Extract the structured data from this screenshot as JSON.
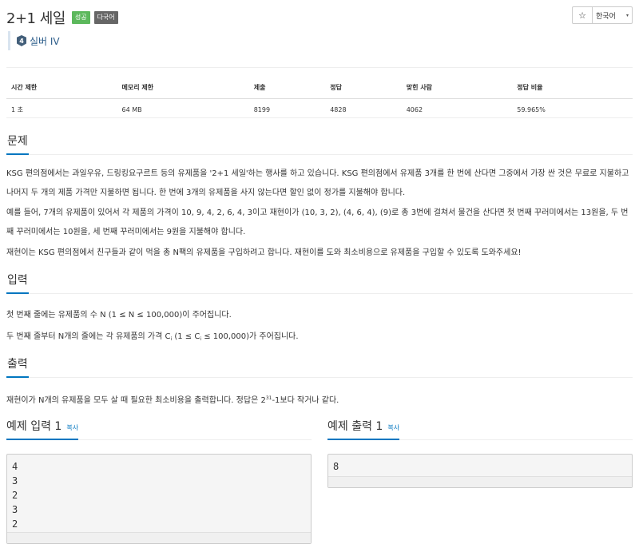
{
  "problem": {
    "title": "2+1 세일",
    "badges": {
      "result": "성공",
      "language": "다국어"
    },
    "tier": {
      "level_numeral": "4",
      "label": "실버 IV"
    }
  },
  "toolbar": {
    "star": "☆",
    "language": "한국어",
    "caret": "▾"
  },
  "info_table": {
    "headers": [
      "시간 제한",
      "메모리 제한",
      "제출",
      "정답",
      "맞힌 사람",
      "정답 비율"
    ],
    "values": [
      "1 초",
      "64 MB",
      "8199",
      "4828",
      "4062",
      "59.965%"
    ]
  },
  "sections": {
    "problem": {
      "heading": "문제",
      "paragraphs": [
        "KSG 편의점에서는 과일우유, 드링킹요구르트 등의 유제품을 '2+1 세일'하는 행사를 하고 있습니다. KSG 편의점에서 유제품 3개를 한 번에 산다면 그중에서 가장 싼 것은 무료로 지불하고 나머지 두 개의 제품 가격만 지불하면 됩니다. 한 번에 3개의 유제품을 사지 않는다면 할인 없이 정가를 지불해야 합니다.",
        "예를 들어, 7개의 유제품이 있어서 각 제품의 가격이 10, 9, 4, 2, 6, 4, 3이고 재현이가 (10, 3, 2), (4, 6, 4), (9)로 총 3번에 걸쳐서 물건을 산다면 첫 번째 꾸러미에서는 13원을, 두 번째 꾸러미에서는 10원을, 세 번째 꾸러미에서는 9원을 지불해야 합니다.",
        "재현이는 KSG 편의점에서 친구들과 같이 먹을 총 N팩의 유제품을 구입하려고 합니다. 재현이를 도와 최소비용으로 유제품을 구입할 수 있도록 도와주세요!"
      ]
    },
    "input": {
      "heading": "입력",
      "line1": "첫 번째 줄에는 유제품의 수 N (1 ≤ N ≤ 100,000)이 주어집니다.",
      "line2_pre": "두 번째 줄부터 N개의 줄에는 각 유제품의 가격 C",
      "line2_sub1": "i",
      "line2_mid": " (1 ≤ C",
      "line2_sub2": "i",
      "line2_post": " ≤ 100,000)가 주어집니다."
    },
    "output": {
      "heading": "출력",
      "line_pre": "재현이가 N개의 유제품을 모두 살 때 필요한 최소비용을 출력합니다. 정답은 2",
      "line_sup": "31",
      "line_post": "-1보다 작거나 같다."
    }
  },
  "examples": {
    "input": {
      "heading": "예제 입력 1",
      "copy": "복사",
      "lines": [
        "4",
        "3",
        "2",
        "3",
        "2"
      ]
    },
    "output": {
      "heading": "예제 출력 1",
      "copy": "복사",
      "lines": [
        "8"
      ]
    }
  }
}
